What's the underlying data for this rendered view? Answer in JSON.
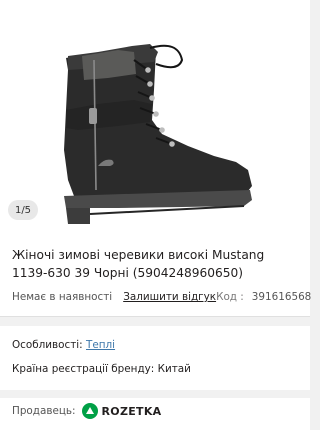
{
  "gallery": {
    "image_alt": "Black women's winter lace-up boot with side zipper",
    "counter": "1/5"
  },
  "product": {
    "title": "Жіночі зимові черевики високі Mustang 1139-630 39 Чорні (5904248960650)",
    "availability": "Немає в наявності",
    "review_link": "Залишити відгук",
    "code_label": "Код :",
    "code_value": "391616568"
  },
  "features": {
    "label": "Особливості:",
    "value": "Теплі",
    "country_label": "Країна реєстрації бренду:",
    "country_value": "Китай"
  },
  "seller": {
    "label": "Продавець:",
    "name": "ROZETKA",
    "brand_color": "#00a046"
  },
  "colors": {
    "link": "#3e77aa",
    "text": "#221f1f",
    "muted": "#797878",
    "page_bg": "#f1f1f1"
  }
}
